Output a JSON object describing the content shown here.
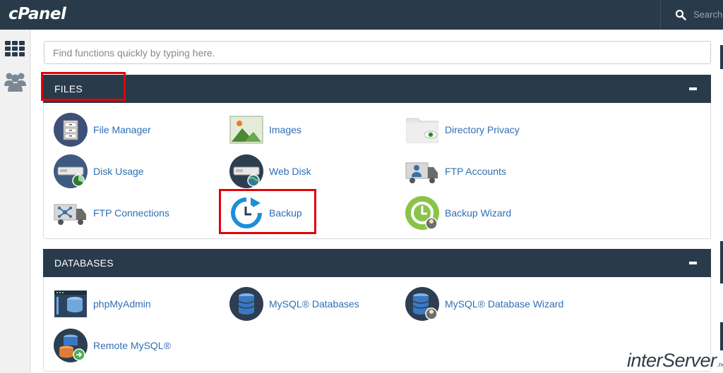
{
  "app": {
    "logo_text": "cPanel"
  },
  "top_search": {
    "label": "Search"
  },
  "sidebar": {
    "items": [
      {
        "icon": "grid-icon"
      },
      {
        "icon": "users-icon"
      }
    ]
  },
  "quick_search": {
    "placeholder": "Find functions quickly by typing here."
  },
  "sections": {
    "files": {
      "title": "FILES",
      "items": [
        {
          "label": "File Manager",
          "icon": "file-manager-icon"
        },
        {
          "label": "Images",
          "icon": "images-icon"
        },
        {
          "label": "Directory Privacy",
          "icon": "directory-privacy-icon"
        },
        {
          "label": "Disk Usage",
          "icon": "disk-usage-icon"
        },
        {
          "label": "Web Disk",
          "icon": "web-disk-icon"
        },
        {
          "label": "FTP Accounts",
          "icon": "ftp-accounts-icon"
        },
        {
          "label": "FTP Connections",
          "icon": "ftp-connections-icon"
        },
        {
          "label": "Backup",
          "icon": "backup-icon"
        },
        {
          "label": "Backup Wizard",
          "icon": "backup-wizard-icon"
        }
      ]
    },
    "databases": {
      "title": "DATABASES",
      "items": [
        {
          "label": "phpMyAdmin",
          "icon": "phpmyadmin-icon"
        },
        {
          "label": "MySQL® Databases",
          "icon": "mysql-databases-icon"
        },
        {
          "label": "MySQL® Database Wizard",
          "icon": "mysql-database-wizard-icon"
        },
        {
          "label": "Remote MySQL®",
          "icon": "remote-mysql-icon"
        }
      ]
    }
  },
  "watermark": {
    "text": "interServer",
    "suffix": ".net"
  },
  "colors": {
    "header": "#293a4a",
    "link": "#2f6fb5",
    "highlight": "#e0040b"
  }
}
